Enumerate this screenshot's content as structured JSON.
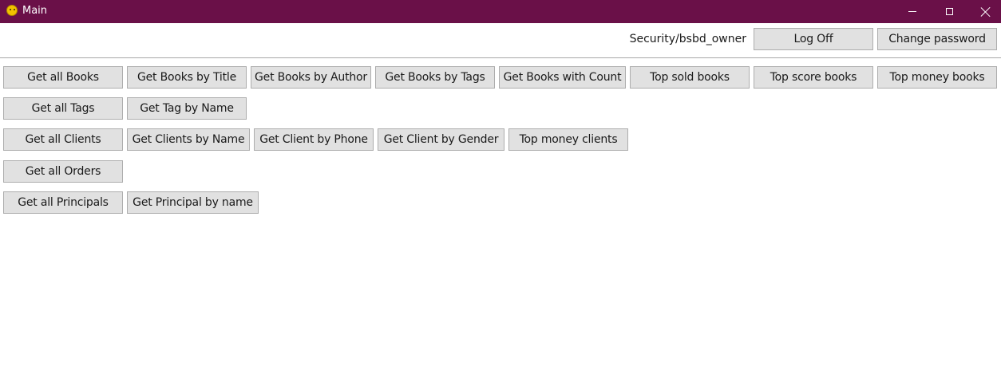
{
  "window": {
    "title": "Main",
    "titlebar_color": "#6a1048",
    "icons": [
      "app-smiley-icon",
      "minimize-icon",
      "maximize-icon",
      "close-icon"
    ]
  },
  "header": {
    "user": "Security/bsbd_owner",
    "log_off": "Log Off",
    "change_password": "Change password"
  },
  "rows": {
    "books": [
      "Get all Books",
      "Get Books by Title",
      "Get Books by Author",
      "Get Books by Tags",
      "Get Books with Count",
      "Top sold books",
      "Top score books",
      "Top money books"
    ],
    "tags": [
      "Get all Tags",
      "Get Tag by Name"
    ],
    "clients": [
      "Get all Clients",
      "Get Clients by Name",
      "Get Client by Phone",
      "Get Client by Gender",
      "Top money clients"
    ],
    "orders": [
      "Get all Orders"
    ],
    "principals": [
      "Get all Principals",
      "Get Principal by name"
    ]
  }
}
